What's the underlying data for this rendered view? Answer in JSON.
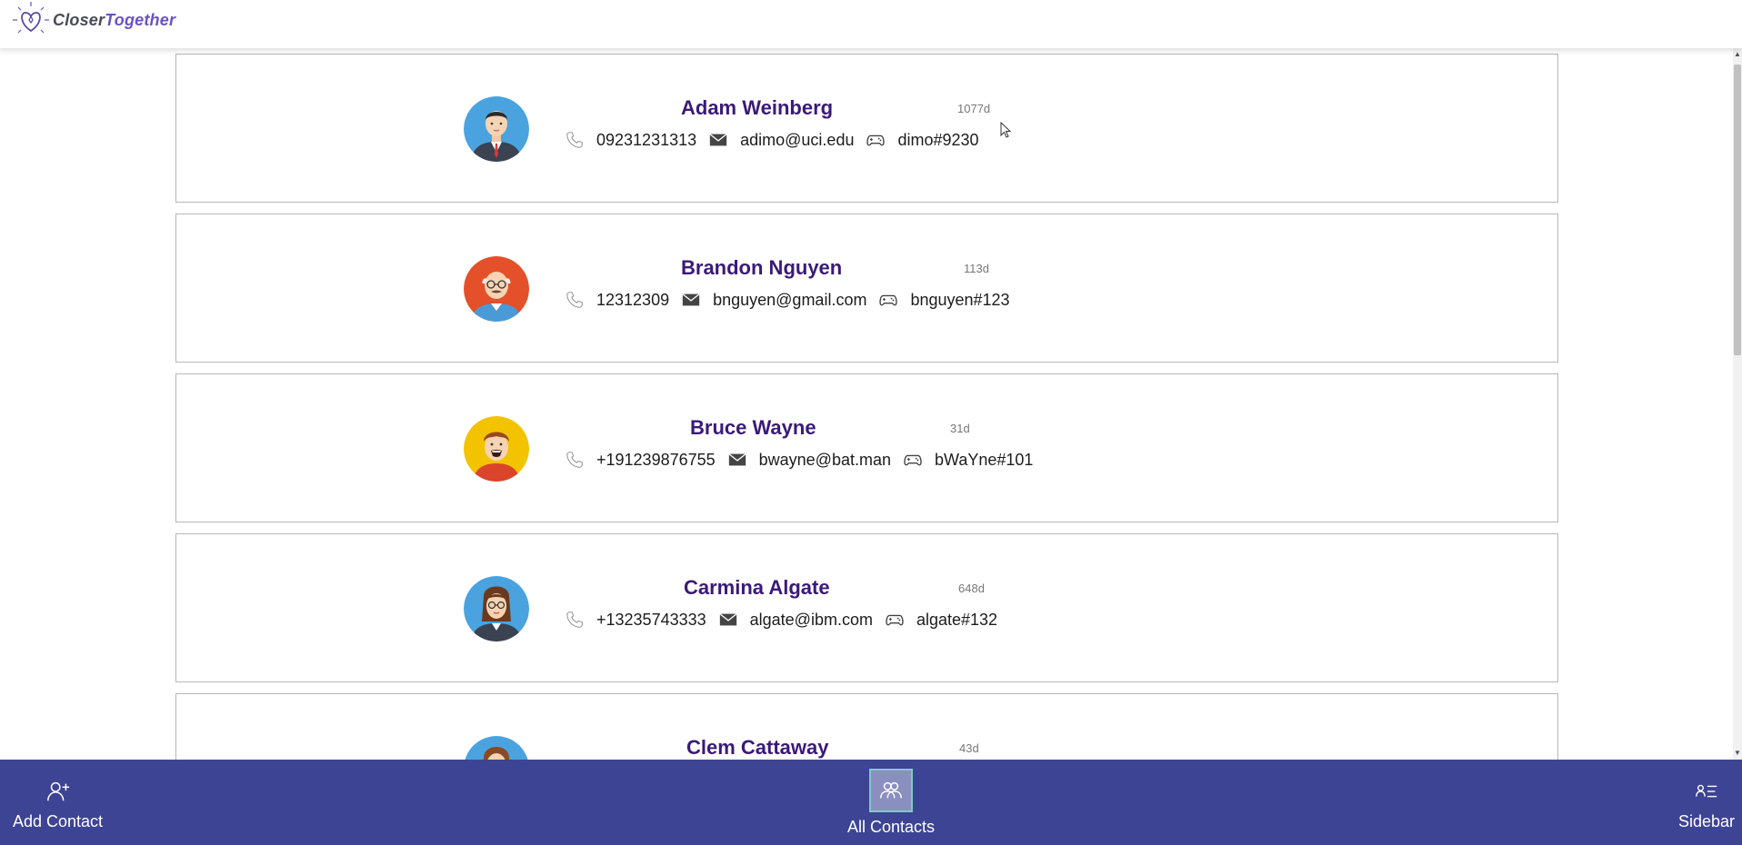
{
  "header": {
    "logo_text_a": "Closer",
    "logo_text_b": "Together"
  },
  "contacts": [
    {
      "name": "Adam Weinberg",
      "days": "1077d",
      "phone": "09231231313",
      "email": "adimo@uci.edu",
      "gamertag": "dimo#9230",
      "avatar": "man-suit-avatar"
    },
    {
      "name": "Brandon Nguyen",
      "days": "113d",
      "phone": "12312309",
      "email": "bnguyen@gmail.com",
      "gamertag": "bnguyen#123",
      "avatar": "old-man-glasses-avatar"
    },
    {
      "name": "Bruce Wayne",
      "days": "31d",
      "phone": "+191239876755",
      "email": "bwayne@bat.man",
      "gamertag": "bWaYne#101",
      "avatar": "laughing-man-avatar"
    },
    {
      "name": "Carmina Algate",
      "days": "648d",
      "phone": "+13235743333",
      "email": "algate@ibm.com",
      "gamertag": "algate#132",
      "avatar": "woman-glasses-avatar"
    },
    {
      "name": "Clem Cattaway",
      "days": "43d",
      "phone": "",
      "email": "",
      "gamertag": "",
      "avatar": "woman-avatar"
    }
  ],
  "bottombar": {
    "add_label": "Add Contact",
    "all_label": "All Contacts",
    "sidebar_label": "Sidebar"
  },
  "colors": {
    "accent": "#3d4494",
    "name": "#3a1a78",
    "active_tab": "#8a8fbf"
  }
}
